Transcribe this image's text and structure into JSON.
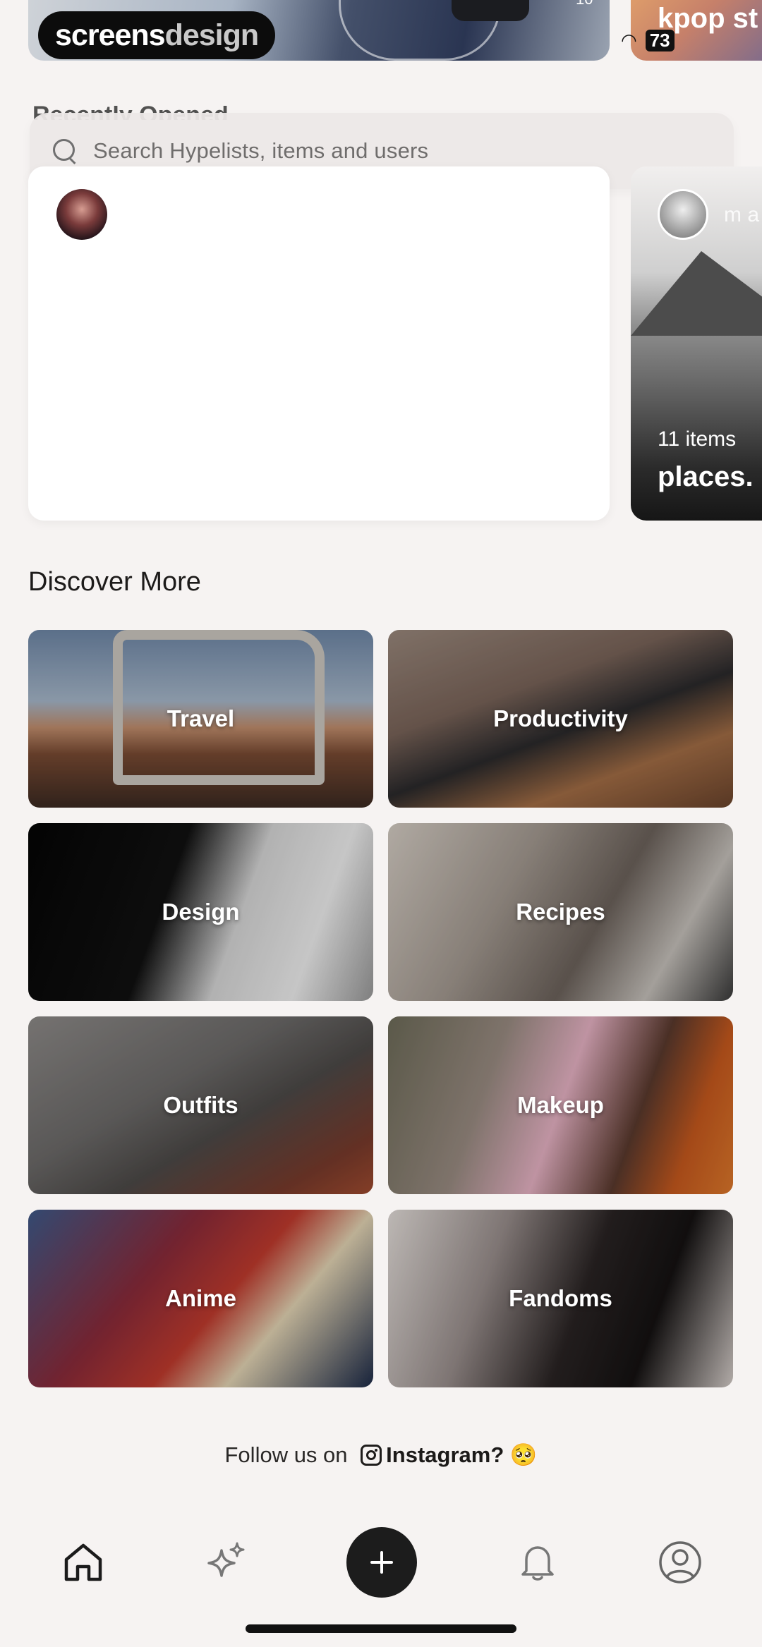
{
  "watermark": {
    "part1": "screens",
    "part2": "design"
  },
  "top_feed": {
    "card1_count": "10",
    "card2_title": "kpop st",
    "battery": "73"
  },
  "search": {
    "placeholder": "Search Hypelists, items and users"
  },
  "recents_header": "Recently Opened",
  "hypelists": [
    {
      "user": "",
      "items": "",
      "title": ""
    },
    {
      "user": "m a",
      "items": "11 items",
      "title": "places."
    }
  ],
  "discover": {
    "title": "Discover More",
    "tiles": [
      {
        "label": "Travel"
      },
      {
        "label": "Productivity"
      },
      {
        "label": "Design"
      },
      {
        "label": "Recipes"
      },
      {
        "label": "Outfits"
      },
      {
        "label": "Makeup"
      },
      {
        "label": "Anime"
      },
      {
        "label": "Fandoms"
      }
    ]
  },
  "footer": {
    "follow_prefix": "Follow us on",
    "instagram": "Instagram?",
    "emoji": "🥺"
  },
  "nav": {
    "icons": [
      "home-icon",
      "sparkles-icon",
      "plus-icon",
      "bell-icon",
      "profile-icon"
    ]
  }
}
